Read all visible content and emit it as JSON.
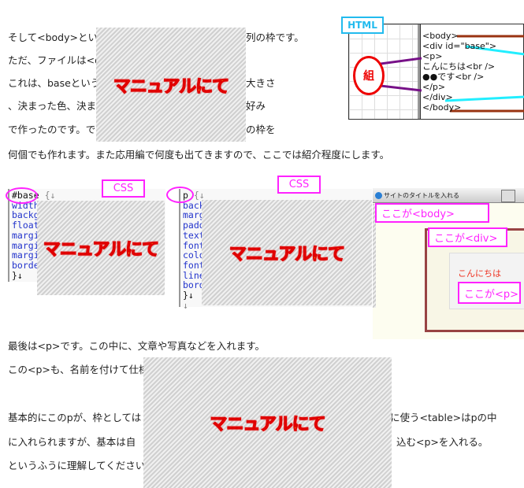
{
  "paragraph1": [
    {
      "left": "そして<body>という",
      "right": "列の枠です。"
    },
    {
      "left": "ただ、ファイルは<di",
      "right": ""
    },
    {
      "left": "これは、baseという",
      "right": "大きさ"
    },
    {
      "left": "、決まった色、決ま",
      "right": "好み"
    },
    {
      "left": "で作ったのです。で",
      "right": "の枠を"
    },
    {
      "left": "何個でも作れます。また応用編で何度も出てきますので、ここでは紹介程度にします。",
      "right": ""
    }
  ],
  "overlay_text": "マニュアルにて",
  "html_figure": {
    "tab": "HTML",
    "circle_label": "組",
    "lines": [
      "<body>",
      "<div id=\"base\">",
      "<p>",
      "こんにちは<br />",
      "●●です<br />",
      "</p>",
      "</div>",
      "</body>"
    ]
  },
  "css1": {
    "tab": "CSS",
    "selector": "#base",
    "brace": "{↓",
    "lines": [
      "width:",
      "backgr",
      "float:",
      "margin",
      "margin",
      "margin",
      "border"
    ],
    "close": "}↓"
  },
  "css2": {
    "tab": "CSS",
    "selector": "p",
    "brace": "{↓",
    "lines": [
      "back",
      "marg",
      "padd",
      "text-",
      "font-",
      "colo",
      "font-",
      "line-",
      "bord"
    ],
    "close": "}↓",
    "extra": "↓"
  },
  "browser": {
    "title": "サイトのタイトルを入れる",
    "body_label": "ここが<body>",
    "div_label": "ここが<div>",
    "greeting": "こんにちは",
    "p_label": "ここが<p>"
  },
  "paragraph2": [
    {
      "left": "最後は<p>です。この中に、文章や写真などを入れます。",
      "right": ""
    },
    {
      "left": "この<p>も、名前を付けて仕様",
      "right": ""
    },
    {
      "left": "基本的にこのpが、枠としては",
      "right": "に使う<table>はpの中"
    },
    {
      "left": "に入れられますが、基本は自",
      "right": "込む<p>を入れる。"
    },
    {
      "left": "というふうに理解してください。",
      "right": ""
    }
  ],
  "colors": {
    "accent": "#ff22ff",
    "overlay_fill": "#ffee00",
    "overlay_stroke": "#e00000",
    "html_tab": "#22bbee"
  }
}
